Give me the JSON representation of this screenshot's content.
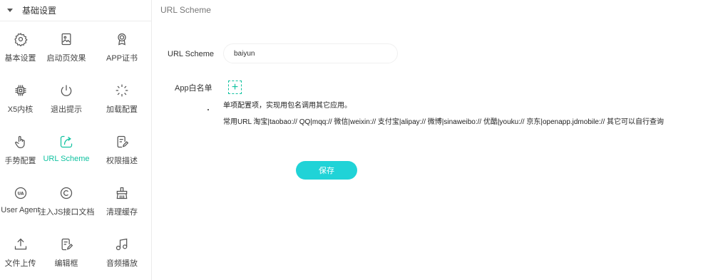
{
  "sidebar": {
    "section_title": "基础设置",
    "items": [
      {
        "label": "基本设置",
        "icon": "gear-icon"
      },
      {
        "label": "启动页效果",
        "icon": "image-icon"
      },
      {
        "label": "APP证书",
        "icon": "certificate-icon"
      },
      {
        "label": "X5内核",
        "icon": "chip-icon"
      },
      {
        "label": "退出提示",
        "icon": "power-icon"
      },
      {
        "label": "加载配置",
        "icon": "spinner-icon"
      },
      {
        "label": "手势配置",
        "icon": "hand-icon"
      },
      {
        "label": "URL Scheme",
        "icon": "link-icon",
        "active": true
      },
      {
        "label": "权限描述",
        "icon": "edit-document-icon"
      },
      {
        "label": "User Agent",
        "icon": "ua-icon"
      },
      {
        "label": "注入JS接口文档",
        "icon": "copyright-icon"
      },
      {
        "label": "清理缓存",
        "icon": "broom-icon"
      },
      {
        "label": "文件上传",
        "icon": "upload-icon"
      },
      {
        "label": "编辑框",
        "icon": "pencil-icon"
      },
      {
        "label": "音频播放",
        "icon": "music-icon"
      }
    ]
  },
  "main": {
    "title": "URL Scheme",
    "url_scheme_label": "URL Scheme",
    "url_scheme_value": "baiyun",
    "whitelist_label": "App白名单",
    "add_symbol": "+",
    "desc_line1": "单项配置项，实现用包名调用其它应用。",
    "desc_line2": "常用URL 淘宝|taobao:// QQ|mqq:// 微信|weixin:// 支付宝|alipay:// 微博|sinaweibo:// 优酷|youku:// 京东|openapp.jdmobile:// 其它可以自行查询",
    "save_label": "保存"
  },
  "colors": {
    "accent": "#10c2a0",
    "save_button": "#20d3d7"
  }
}
